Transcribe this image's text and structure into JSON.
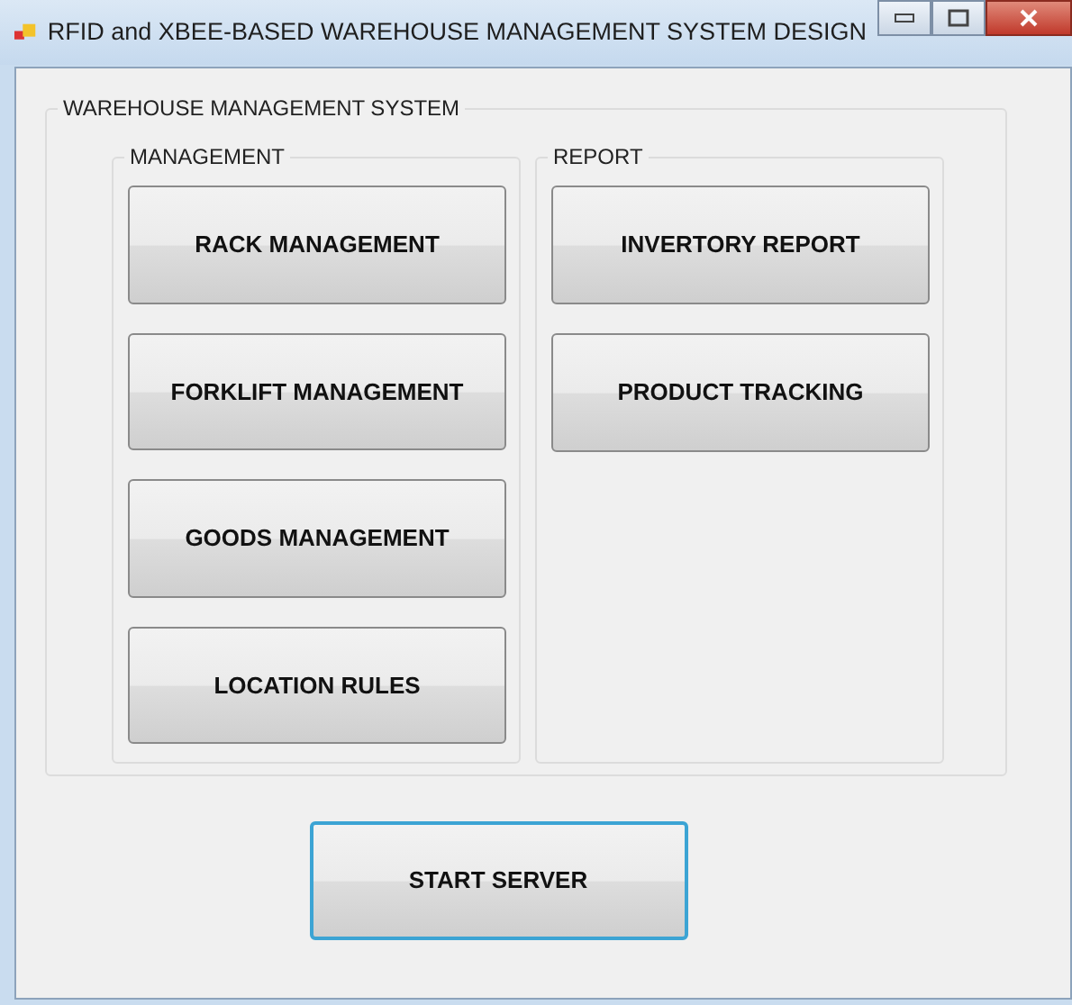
{
  "window": {
    "title": "RFID and XBEE-BASED WAREHOUSE MANAGEMENT SYSTEM DESIGN"
  },
  "group": {
    "title": "WAREHOUSE MANAGEMENT SYSTEM",
    "sections": [
      {
        "title": "MANAGEMENT",
        "buttons": [
          {
            "label": "RACK MANAGEMENT",
            "focused": false
          },
          {
            "label": "FORKLIFT MANAGEMENT",
            "focused": false
          },
          {
            "label": "GOODS MANAGEMENT",
            "focused": false
          },
          {
            "label": "LOCATION RULES",
            "focused": false
          }
        ]
      },
      {
        "title": "REPORT",
        "buttons": [
          {
            "label": "INVERTORY REPORT",
            "focused": false
          },
          {
            "label": "PRODUCT TRACKING",
            "focused": false
          }
        ]
      }
    ]
  },
  "start_button": {
    "label": "START SERVER",
    "focused": true
  }
}
